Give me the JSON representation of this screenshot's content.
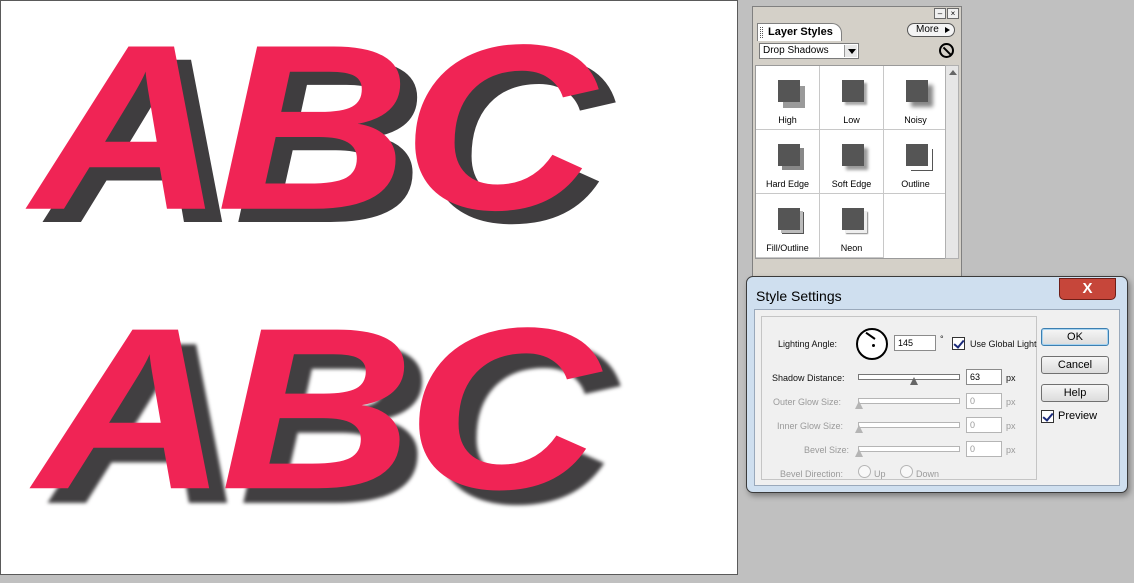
{
  "canvas": {
    "row1": [
      "A",
      "B",
      "C"
    ],
    "row2": [
      "A",
      "B",
      "C"
    ],
    "text_color": "#f02455",
    "shadow_color": "#3f3d3f"
  },
  "palette": {
    "title": "Layer Styles",
    "more_label": "More",
    "dropdown_value": "Drop Shadows",
    "styles": [
      {
        "label": "High"
      },
      {
        "label": "Low"
      },
      {
        "label": "Noisy"
      },
      {
        "label": "Hard Edge"
      },
      {
        "label": "Soft Edge"
      },
      {
        "label": "Outline"
      },
      {
        "label": "Fill/Outline"
      },
      {
        "label": "Neon"
      }
    ]
  },
  "dialog": {
    "title": "Style Settings",
    "close_label": "X",
    "lighting_angle_label": "Lighting Angle:",
    "lighting_angle_value": "145",
    "degree_symbol": "°",
    "use_global_light_label": "Use Global Light",
    "use_global_light_checked": true,
    "shadow_distance_label": "Shadow Distance:",
    "shadow_distance_value": "63",
    "outer_glow_label": "Outer Glow Size:",
    "outer_glow_value": "0",
    "inner_glow_label": "Inner Glow Size:",
    "inner_glow_value": "0",
    "bevel_size_label": "Bevel Size:",
    "bevel_size_value": "0",
    "unit_px": "px",
    "bevel_direction_label": "Bevel Direction:",
    "bevel_up_label": "Up",
    "bevel_down_label": "Down",
    "ok_label": "OK",
    "cancel_label": "Cancel",
    "help_label": "Help",
    "preview_label": "Preview",
    "preview_checked": true
  }
}
